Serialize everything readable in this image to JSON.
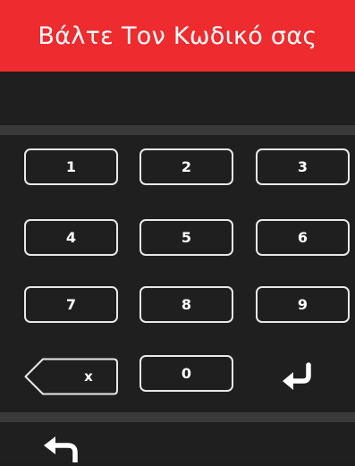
{
  "header": {
    "title": "Βάλτε Τον Κωδικό σας"
  },
  "code_input": {
    "value": ""
  },
  "keypad": {
    "keys": [
      "1",
      "2",
      "3",
      "4",
      "5",
      "6",
      "7",
      "8",
      "9",
      "0"
    ],
    "backspace_label": "x"
  },
  "icons": {
    "enter": "enter-return-icon",
    "back": "back-arrow-icon",
    "backspace": "backspace-icon"
  },
  "colors": {
    "header_bg": "#ee2b2e",
    "screen_bg": "#1f1f1f",
    "divider": "#3a3a3a",
    "key_border": "#e8e8e8",
    "text": "#ffffff"
  }
}
